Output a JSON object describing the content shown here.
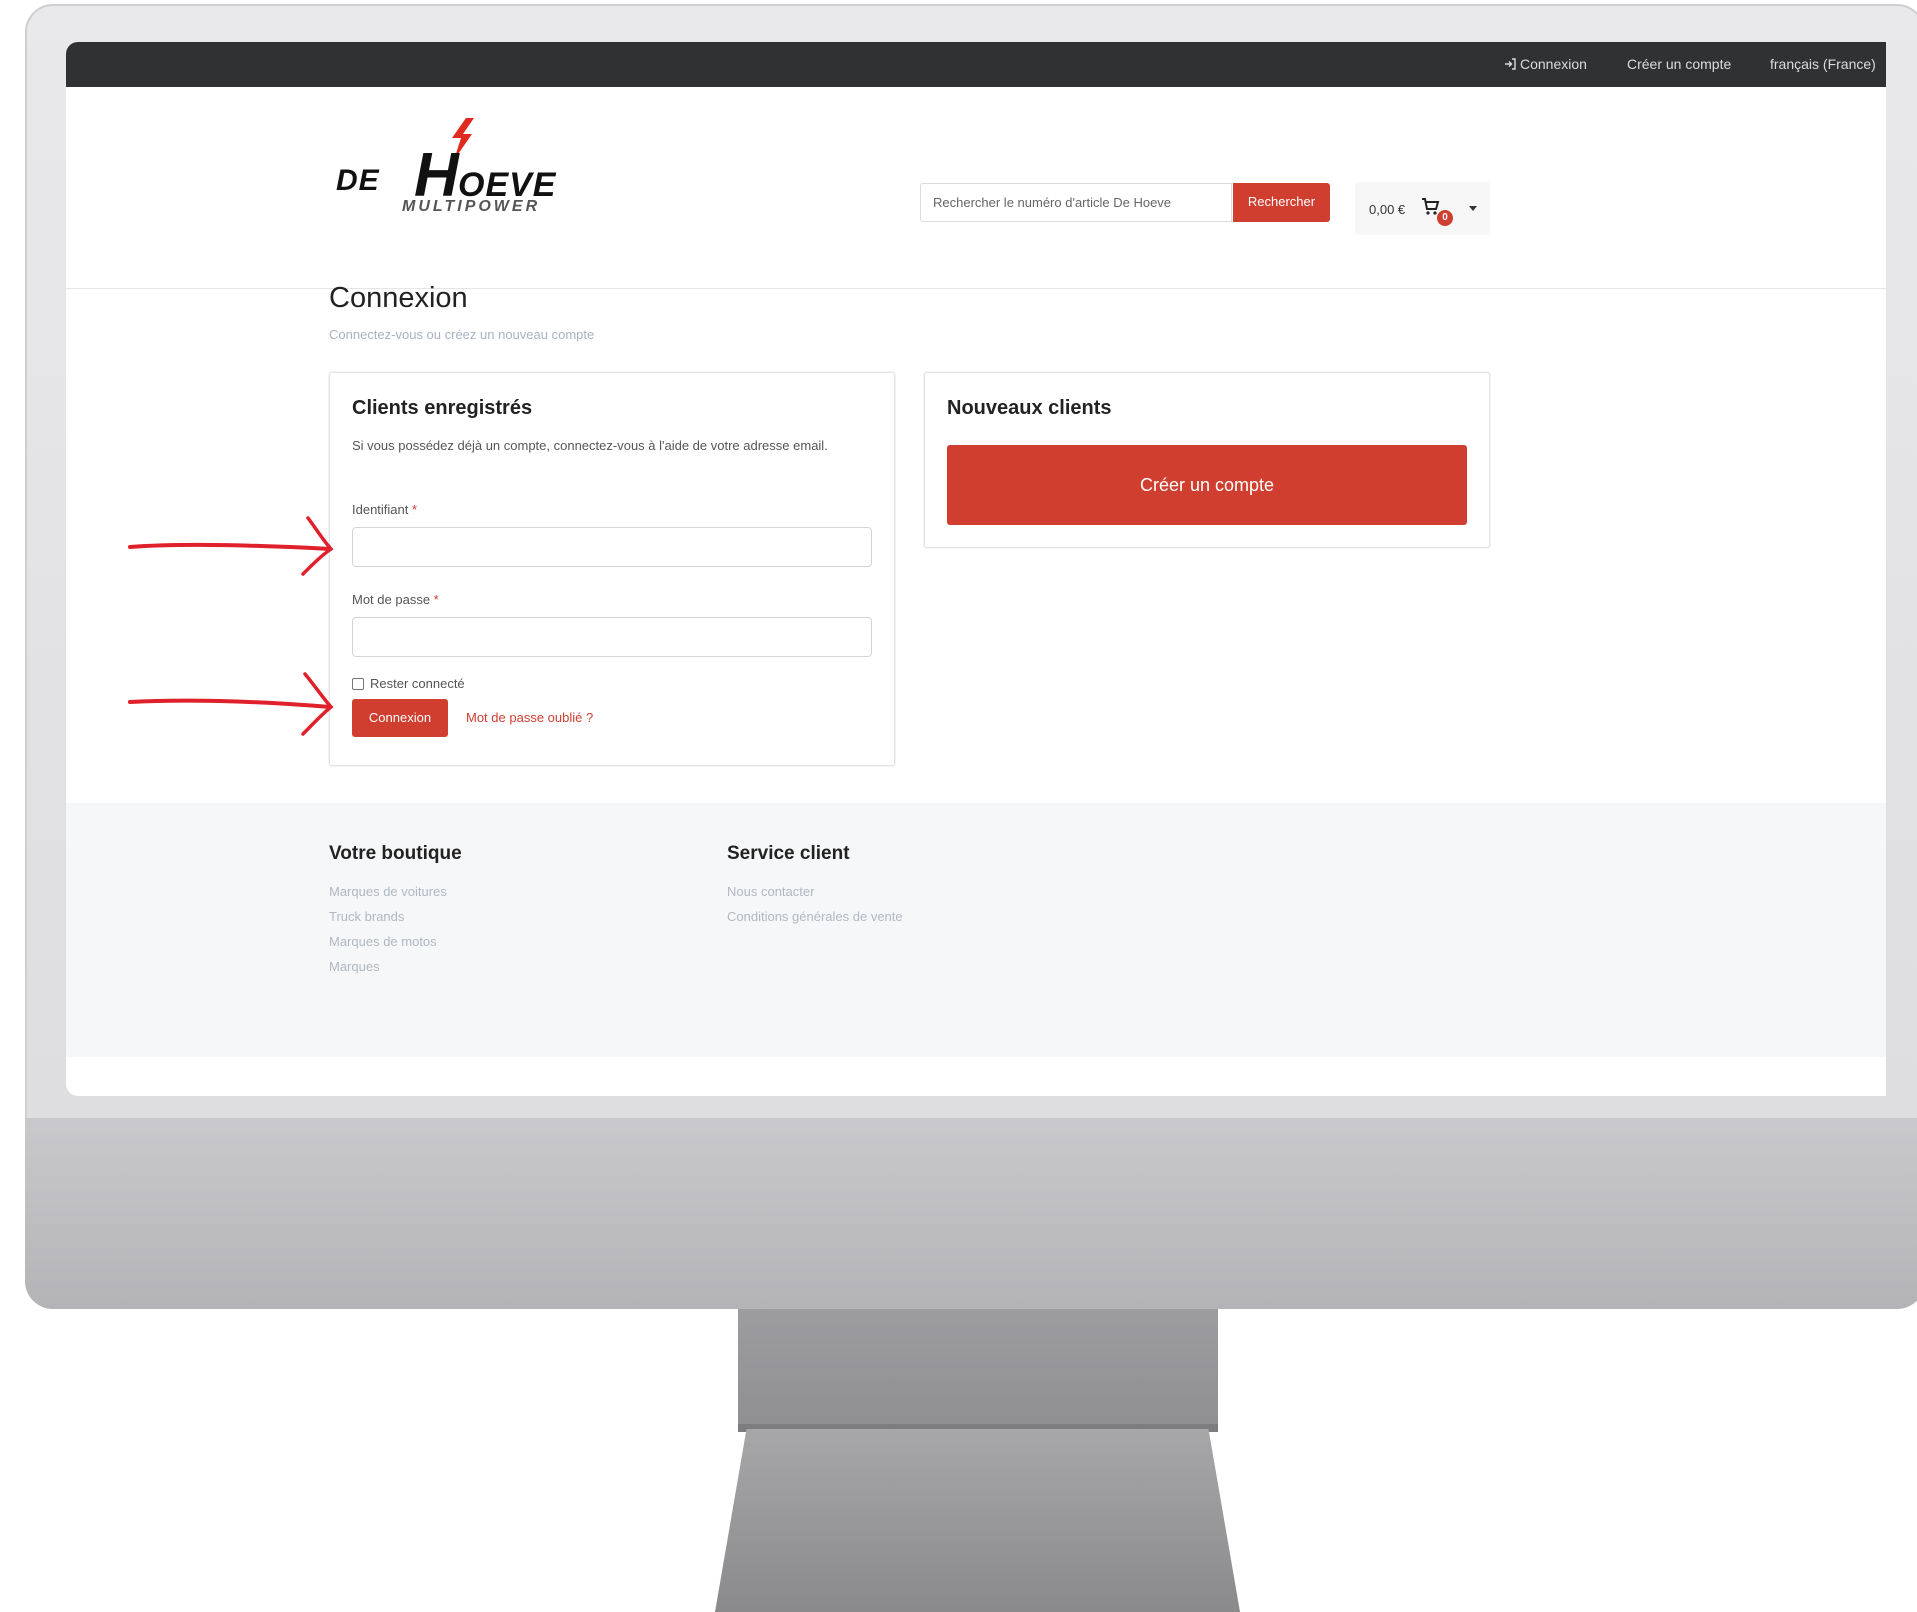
{
  "topbar": {
    "login": "Connexion",
    "create_account": "Créer un compte",
    "language": "français (France)"
  },
  "header": {
    "logo": {
      "de": "DE",
      "h": "H",
      "oeve": "OEVE",
      "multipower": "MULTIPOWER"
    },
    "search_placeholder": "Rechercher le numéro d'article De Hoeve",
    "search_button": "Rechercher",
    "cart_amount": "0,00 €",
    "cart_count": "0"
  },
  "page": {
    "title": "Connexion",
    "subtitle": "Connectez-vous ou créez un nouveau compte"
  },
  "registered": {
    "title": "Clients enregistrés",
    "description": "Si vous possédez déjà un compte, connectez-vous à l'aide de votre adresse email.",
    "username_label": "Identifiant",
    "password_label": "Mot de passe",
    "required_mark": "*",
    "remember_label": "Rester connecté",
    "login_button": "Connexion",
    "forgot_link": "Mot de passe oublié ?"
  },
  "new_customers": {
    "title": "Nouveaux clients",
    "create_button": "Créer un compte"
  },
  "footer": {
    "shop": {
      "title": "Votre boutique",
      "links": [
        "Marques de voitures",
        "Truck brands",
        "Marques de motos",
        "Marques"
      ]
    },
    "service": {
      "title": "Service client",
      "links": [
        "Nous contacter",
        "Conditions générales de vente"
      ]
    }
  },
  "colors": {
    "accent": "#cf3e2f",
    "topbar": "#2f3132",
    "annotation_arrow": "#e0202a"
  }
}
